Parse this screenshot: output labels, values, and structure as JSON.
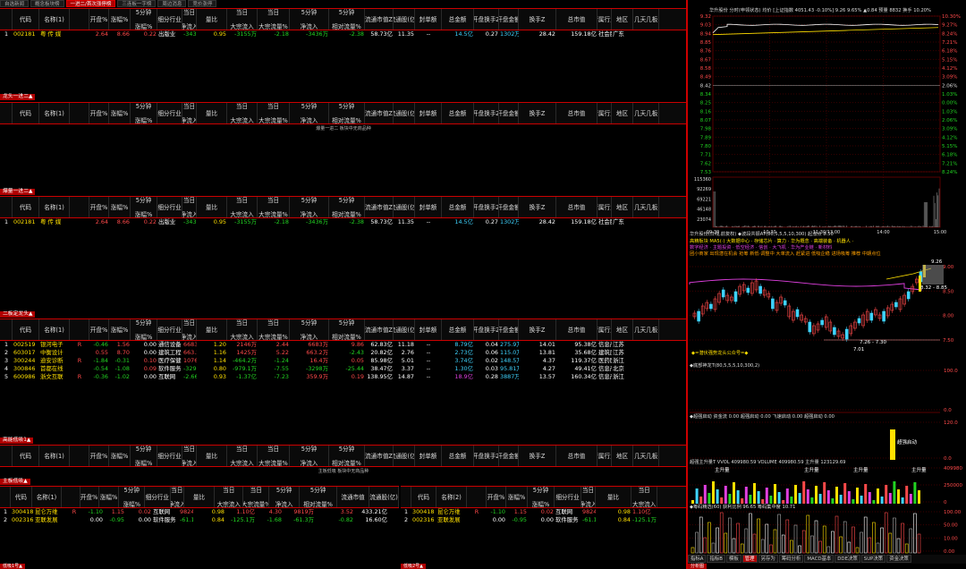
{
  "tabs": [
    {
      "label": "自选新闻",
      "active": false
    },
    {
      "label": "概念板块榜",
      "active": false
    },
    {
      "label": "一进二/首次涨停榜",
      "active": true
    },
    {
      "label": "三连板一字榜",
      "active": false
    },
    {
      "label": "周边消息",
      "active": false
    },
    {
      "label": "竞价涨停",
      "active": false
    }
  ],
  "columns": [
    "代码",
    "名称(1)",
    "开盘%",
    "涨幅%",
    "5分钟\n涨幅%",
    "细分行业",
    "当日\n净流入",
    "量比",
    "当日\n大宗流入",
    "当日\n大宗流量%",
    "5分钟\n净流入",
    "5分钟\n相对流量%",
    "流通市值Z",
    "流通股(亿)",
    "封单额",
    "总金额",
    "开盘换手Z",
    "开盘金额",
    "换手Z",
    "总市值",
    "所属行业",
    "地区",
    "几天几板"
  ],
  "columns_sm": [
    "代码",
    "名称(1)",
    "开盘%",
    "涨幅%",
    "5分钟\n涨幅%",
    "细分行业",
    "当日\n净流入",
    "量比",
    "当日\n大宗流入",
    "当日\n大宗流量%",
    "5分钟\n净流入",
    "5分钟\n相对流量%",
    "流通市值",
    "流通股(亿)"
  ],
  "columns_sm2": [
    "代码",
    "名称(2)",
    "开盘%",
    "涨幅%",
    "5分钟\n涨幅%",
    "细分行业",
    "当日\n净流入",
    "量比",
    "当日\n大宗流入"
  ],
  "sections": {
    "s1": "龙头一进二▲",
    "s2": "爆量一进二▲",
    "s3": "二板定龙头▲",
    "s4": "高能低吸1▲",
    "s5": "主板低吸▲",
    "s6": "低吸1号▲",
    "s7": "低吸2号▲"
  },
  "empty1": "爆量一进二 板块中无商品种",
  "empty2": "主板低吸 板块中无商品种",
  "table1": [
    {
      "idx": "1",
      "code": "002181",
      "name": "粤 传 媒",
      "f": "",
      "open": "2.64",
      "chg": "8.66",
      "m5": "0.22",
      "ind": "出版业",
      "net": "-3439万",
      "vr": "0.95",
      "big": "-3155万",
      "bigp": "-2.18",
      "m5net": "-3436万",
      "m5p": "-2.38",
      "mcap": "58.73亿",
      "shares": "11.35",
      "seal": "--",
      "amt": "14.5亿",
      "oturn": "0.27",
      "oamt": "1302万",
      "turn": "28.42",
      "tcap": "159.18亿",
      "sector": "社会服务-传媒娱乐",
      "area": "广东",
      "boards": ""
    }
  ],
  "table3": [
    {
      "idx": "1",
      "code": "002181",
      "name": "粤 传 媒",
      "f": "",
      "open": "2.64",
      "chg": "8.66",
      "m5": "0.22",
      "ind": "出版业",
      "net": "-3439万",
      "vr": "0.95",
      "big": "-3155万",
      "bigp": "-2.18",
      "m5net": "-3436万",
      "m5p": "-2.38",
      "mcap": "58.73亿",
      "shares": "11.35",
      "seal": "--",
      "amt": "14.5亿",
      "oturn": "0.27",
      "oamt": "1302万",
      "turn": "28.42",
      "tcap": "159.18亿",
      "sector": "社会服务-传媒娱乐",
      "area": "广东",
      "boards": ""
    }
  ],
  "table4": [
    {
      "idx": "1",
      "code": "002519",
      "name": "银河电子",
      "f": "R",
      "open": "-0.46",
      "chg": "1.56",
      "m5": "0.00",
      "ind": "通信设备",
      "net": "6683万",
      "vr": "1.20",
      "big": "2146万",
      "bigp": "2.44",
      "m5net": "6683万",
      "m5p": "9.86",
      "mcap": "62.83亿",
      "shares": "11.18",
      "seal": "--",
      "amt": "8.79亿",
      "oturn": "0.04",
      "oamt": "275.9万",
      "turn": "14.01",
      "tcap": "95.38亿",
      "sector": "信息产业-通信设备",
      "area": "江苏",
      "boards": ""
    },
    {
      "idx": "2",
      "code": "603017",
      "name": "中衡设计",
      "f": "",
      "open": "0.55",
      "chg": "8.70",
      "m5": "0.00",
      "ind": "建筑工程",
      "net": "663.2万",
      "vr": "1.16",
      "big": "1425万",
      "bigp": "5.22",
      "m5net": "663.2万",
      "m5p": "-2.43",
      "mcap": "20.82亿",
      "shares": "2.76",
      "seal": "--",
      "amt": "2.73亿",
      "oturn": "0.06",
      "oamt": "115.0万",
      "turn": "13.81",
      "tcap": "35.68亿",
      "sector": "建筑房产-建筑",
      "area": "江苏",
      "boards": ""
    },
    {
      "idx": "3",
      "code": "300244",
      "name": "迪安诊断",
      "f": "R",
      "open": "-1.84",
      "chg": "-0.31",
      "m5": "0.10",
      "ind": "医疗保健",
      "net": "1076万",
      "vr": "1.14",
      "big": "-464.2万",
      "bigp": "-1.24",
      "m5net": "16.4万",
      "m5p": "0.05",
      "mcap": "85.98亿",
      "shares": "5.01",
      "seal": "--",
      "amt": "3.74亿",
      "oturn": "0.02",
      "oamt": "148.5万",
      "turn": "4.37",
      "tcap": "119.37亿",
      "sector": "医药医疗-医疗保健",
      "area": "浙江",
      "boards": ""
    },
    {
      "idx": "4",
      "code": "300846",
      "name": "首都在线",
      "f": "",
      "open": "-0.54",
      "chg": "-1.08",
      "m5": "0.09",
      "ind": "软件服务",
      "net": "-3298万",
      "vr": "0.80",
      "big": "-979.1万",
      "bigp": "-7.55",
      "m5net": "-3298万",
      "m5p": "-25.44",
      "mcap": "38.47亿",
      "shares": "3.37",
      "seal": "--",
      "amt": "1.30亿",
      "oturn": "0.03",
      "oamt": "95.81万",
      "turn": "4.27",
      "tcap": "49.41亿",
      "sector": "信息产业-软件服务",
      "area": "北京",
      "boards": ""
    },
    {
      "idx": "5",
      "code": "600986",
      "name": "浙文互联",
      "f": "R",
      "open": "-0.36",
      "chg": "-1.02",
      "m5": "0.00",
      "ind": "互联网",
      "net": "-2.66亿",
      "vr": "0.93",
      "big": "-1.37亿",
      "bigp": "-7.23",
      "m5net": "359.9万",
      "m5p": "0.19",
      "mcap": "138.95亿",
      "shares": "14.87",
      "seal": "--",
      "amt": "18.9亿",
      "oturn": "0.28",
      "oamt": "3887万",
      "turn": "13.57",
      "tcap": "160.34亿",
      "sector": "信息产业-互联网",
      "area": "浙江",
      "boards": ""
    }
  ],
  "table6": [
    {
      "idx": "1",
      "code": "300418",
      "name": "昆仑万维",
      "f": "R",
      "open": "-1.10",
      "chg": "1.15",
      "m5": "0.02",
      "ind": "互联网",
      "net": "9824万",
      "vr": "0.98",
      "big": "1.10亿",
      "bigp": "4.30",
      "m5net": "9819万",
      "m5p": "3.52",
      "mcap": "433.21亿",
      "shares": ""
    },
    {
      "idx": "2",
      "code": "002316",
      "name": "亚联发展",
      "f": "",
      "open": "0.00",
      "chg": "-0.95",
      "m5": "0.00",
      "ind": "软件服务",
      "net": "-61.1万",
      "vr": "0.84",
      "big": "-125.1万",
      "bigp": "-1.68",
      "m5net": "-61.3万",
      "m5p": "-0.82",
      "mcap": "16.60亿",
      "shares": ""
    }
  ],
  "table7": [
    {
      "idx": "1",
      "code": "300418",
      "name": "昆仑万维",
      "f": "R",
      "open": "-1.10",
      "chg": "1.15",
      "m5": "0.02",
      "ind": "互联网",
      "net": "9824万",
      "vr": "0.98",
      "big": "1.10亿"
    },
    {
      "idx": "2",
      "code": "002316",
      "name": "亚联发展",
      "f": "",
      "open": "0.00",
      "chg": "-0.95",
      "m5": "0.00",
      "ind": "软件服务",
      "net": "-61.1万",
      "vr": "0.84",
      "big": "-125.1万"
    }
  ],
  "intraday": {
    "title": "华升股份 分时(申领状态) 均价 [上证指数 4051.43 -0.10%] 9.26 9.65% ▲0.84 预量 8832 换手 10.20%",
    "yticks_l": [
      "9.32",
      "9.03",
      "8.94",
      "8.85",
      "8.76",
      "8.67",
      "8.58",
      "8.49",
      "8.42",
      "8.34",
      "8.25",
      "8.16",
      "8.07",
      "7.98",
      "7.89",
      "7.80",
      "7.71",
      "7.62",
      "7.53"
    ],
    "yticks_r": [
      "10.30%",
      "9.27%",
      "8.24%",
      "7.21%",
      "6.18%",
      "5.15%",
      "4.12%",
      "3.09%",
      "2.06%",
      "1.03%",
      "0.00%",
      "1.03%",
      "2.06%",
      "3.09%",
      "4.12%",
      "5.15%",
      "6.18%",
      "7.21%",
      "8.24%"
    ],
    "vol_ticks": [
      "115360",
      "92269",
      "69221",
      "46148",
      "23074"
    ],
    "times": [
      "09:30",
      "10:30",
      "11:30/13:00",
      "14:00",
      "15:00"
    ]
  },
  "kline": {
    "title": "华升股份(日线,前复权) ◆波段共振AT(80,5,5,5,10,300) 起涨点 8.50",
    "legend1": "高精板块 MA5(·) 大数据中心 · 存储芯片 · 算力 · 华为概念 · 高端装备 · 机器人 ·",
    "legend2": "数字经济 · 主题投资 · 低空经济 · 信创 · 大飞机 · 华为产业链 · 新材料",
    "legend3": "团小商家 出现潜在机会 抢筹 新低·调整中 大单流入 赶紧进 低吸企稳 进场吸筹 推荐 中期点位",
    "price_hi": "9.26",
    "price_lo": "7.01",
    "range": "7.26 - 7.30",
    "range2": "8.32 - 8.85",
    "label_top": "9.26",
    "note": "◆=潜伏强势龙头公众号=◆",
    "yticks": [
      "9.00",
      "8.50",
      "8.00",
      "7.50"
    ],
    "p2": "◆底部神龙T(80,5,5,5,10,300,2)",
    "p2_ticks": [
      "100.0",
      "0.0"
    ],
    "p3": "◆超强启动 资金流 0.00 超强启动 0.00 飞速启动 0.00 超强启动 0.00",
    "p3_ticks": [
      "120.0",
      "0.0"
    ],
    "p3_label": "超强启动",
    "p4": "超强主升量T VVOL 409980.59 VOLUME 409980.59 主升量 123129.69",
    "p4_ticks": [
      "409980",
      "250000",
      "0"
    ],
    "p4_labels": [
      "主升量",
      "主升量",
      "主升量",
      "主升量"
    ],
    "p5": "◆筹码精选(60) 获利比例 96.65 筹码集中度 10.71",
    "p5_ticks": [
      "100.00",
      "50.00",
      "10.00",
      "0.00"
    ]
  },
  "bottom_tabs": [
    "指标A",
    "指标B",
    "模板",
    "管理",
    "另存为",
    "筹码分析",
    "MACD基本",
    "DDE决策",
    "SUP决策",
    "资金决策"
  ],
  "bottom_active": 3,
  "bottom_right": "分析图",
  "bottom_low": [
    "低吸1号▲",
    "低吸2号▲"
  ],
  "colors": {
    "up": "#ff4a4a",
    "down": "#22d422",
    "accent": "#b00000",
    "cyan": "#3fd4ff",
    "yellow": "#ffe000"
  }
}
